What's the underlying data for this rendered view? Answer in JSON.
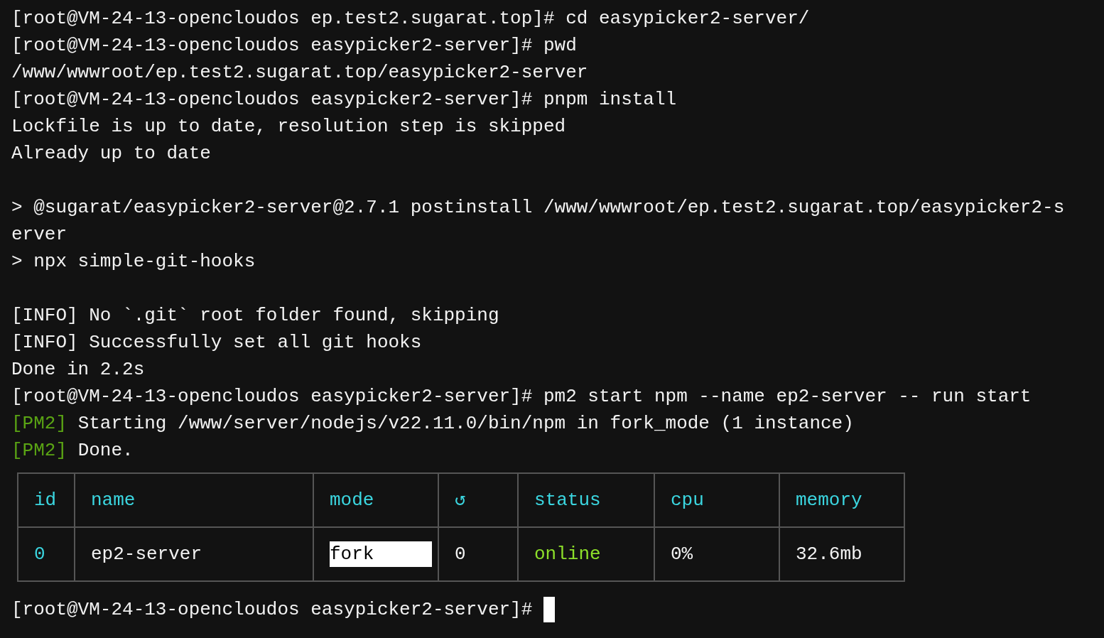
{
  "terminal": {
    "lines": [
      {
        "kind": "text",
        "text": "[root@VM-24-13-opencloudos ep.test2.sugarat.top]# cd easypicker2-server/"
      },
      {
        "kind": "text",
        "text": "[root@VM-24-13-opencloudos easypicker2-server]# pwd"
      },
      {
        "kind": "text",
        "text": "/www/wwwroot/ep.test2.sugarat.top/easypicker2-server"
      },
      {
        "kind": "text",
        "text": "[root@VM-24-13-opencloudos easypicker2-server]# pnpm install"
      },
      {
        "kind": "text",
        "text": "Lockfile is up to date, resolution step is skipped"
      },
      {
        "kind": "text",
        "text": "Already up to date"
      },
      {
        "kind": "blank"
      },
      {
        "kind": "text",
        "text": "> @sugarat/easypicker2-server@2.7.1 postinstall /www/wwwroot/ep.test2.sugarat.top/easypicker2-s"
      },
      {
        "kind": "text",
        "text": "erver"
      },
      {
        "kind": "text",
        "text": "> npx simple-git-hooks"
      },
      {
        "kind": "blank"
      },
      {
        "kind": "text",
        "text": "[INFO] No `.git` root folder found, skipping"
      },
      {
        "kind": "text",
        "text": "[INFO] Successfully set all git hooks"
      },
      {
        "kind": "text",
        "text": "Done in 2.2s"
      },
      {
        "kind": "text",
        "text": "[root@VM-24-13-opencloudos easypicker2-server]# pm2 start npm --name ep2-server -- run start"
      },
      {
        "kind": "tagged",
        "tag": "[PM2]",
        "text": "Starting /www/server/nodejs/v22.11.0/bin/npm in fork_mode (1 instance)"
      },
      {
        "kind": "tagged",
        "tag": "[PM2]",
        "text": "Done."
      }
    ]
  },
  "table": {
    "columns": [
      "id",
      "name",
      "mode",
      "↺",
      "status",
      "cpu",
      "memory"
    ],
    "rows": [
      {
        "cells": [
          {
            "kind": "id",
            "text": "0"
          },
          {
            "kind": "plain",
            "text": "ep2-server"
          },
          {
            "kind": "highlight",
            "text": "fork"
          },
          {
            "kind": "plain",
            "text": "0"
          },
          {
            "kind": "status",
            "text": "online"
          },
          {
            "kind": "plain",
            "text": "0%"
          },
          {
            "kind": "plain",
            "text": "32.6mb"
          }
        ]
      }
    ]
  },
  "prompt": {
    "text": "[root@VM-24-13-opencloudos easypicker2-server]#",
    "cursor": true
  }
}
